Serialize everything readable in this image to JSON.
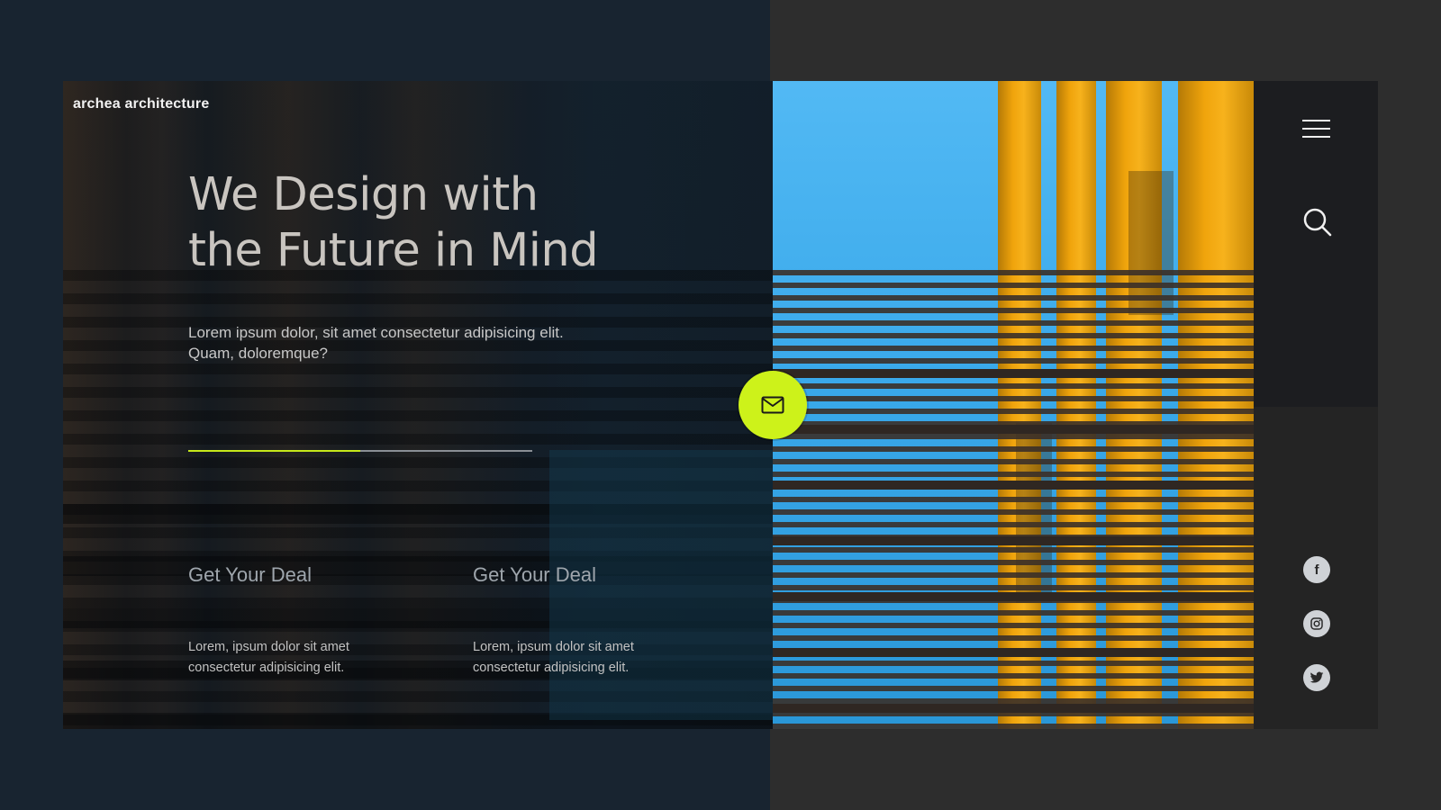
{
  "brand": {
    "name": "archea architecture"
  },
  "hero": {
    "headline_line1": "We Design with",
    "headline_line2": "the Future in Mind",
    "subtext_line1": "Lorem ipsum dolor, sit amet consectetur adipisicing elit.",
    "subtext_line2": "Quam, doloremque?",
    "progress": 0.5
  },
  "deals": [
    {
      "title": "Get Your Deal",
      "text_line1": "Lorem, ipsum dolor sit amet",
      "text_line2": "consectetur adipisicing elit."
    },
    {
      "title": "Get Your Deal",
      "text_line1": "Lorem, ipsum dolor sit amet",
      "text_line2": "consectetur adipisicing elit."
    }
  ],
  "sidebar": {
    "menu_icon": "hamburger-menu-icon",
    "search_icon": "search-icon",
    "social": [
      {
        "icon": "facebook-icon",
        "glyph": "f"
      },
      {
        "icon": "instagram-icon"
      },
      {
        "icon": "twitter-icon"
      }
    ]
  },
  "contact_button": {
    "icon": "mail-icon"
  },
  "colors": {
    "accent": "#cdf21a",
    "left_background": "#182430",
    "right_background": "#2d2d2d",
    "sidebar_top": "#1c1d20",
    "sidebar_bottom": "#242424"
  }
}
